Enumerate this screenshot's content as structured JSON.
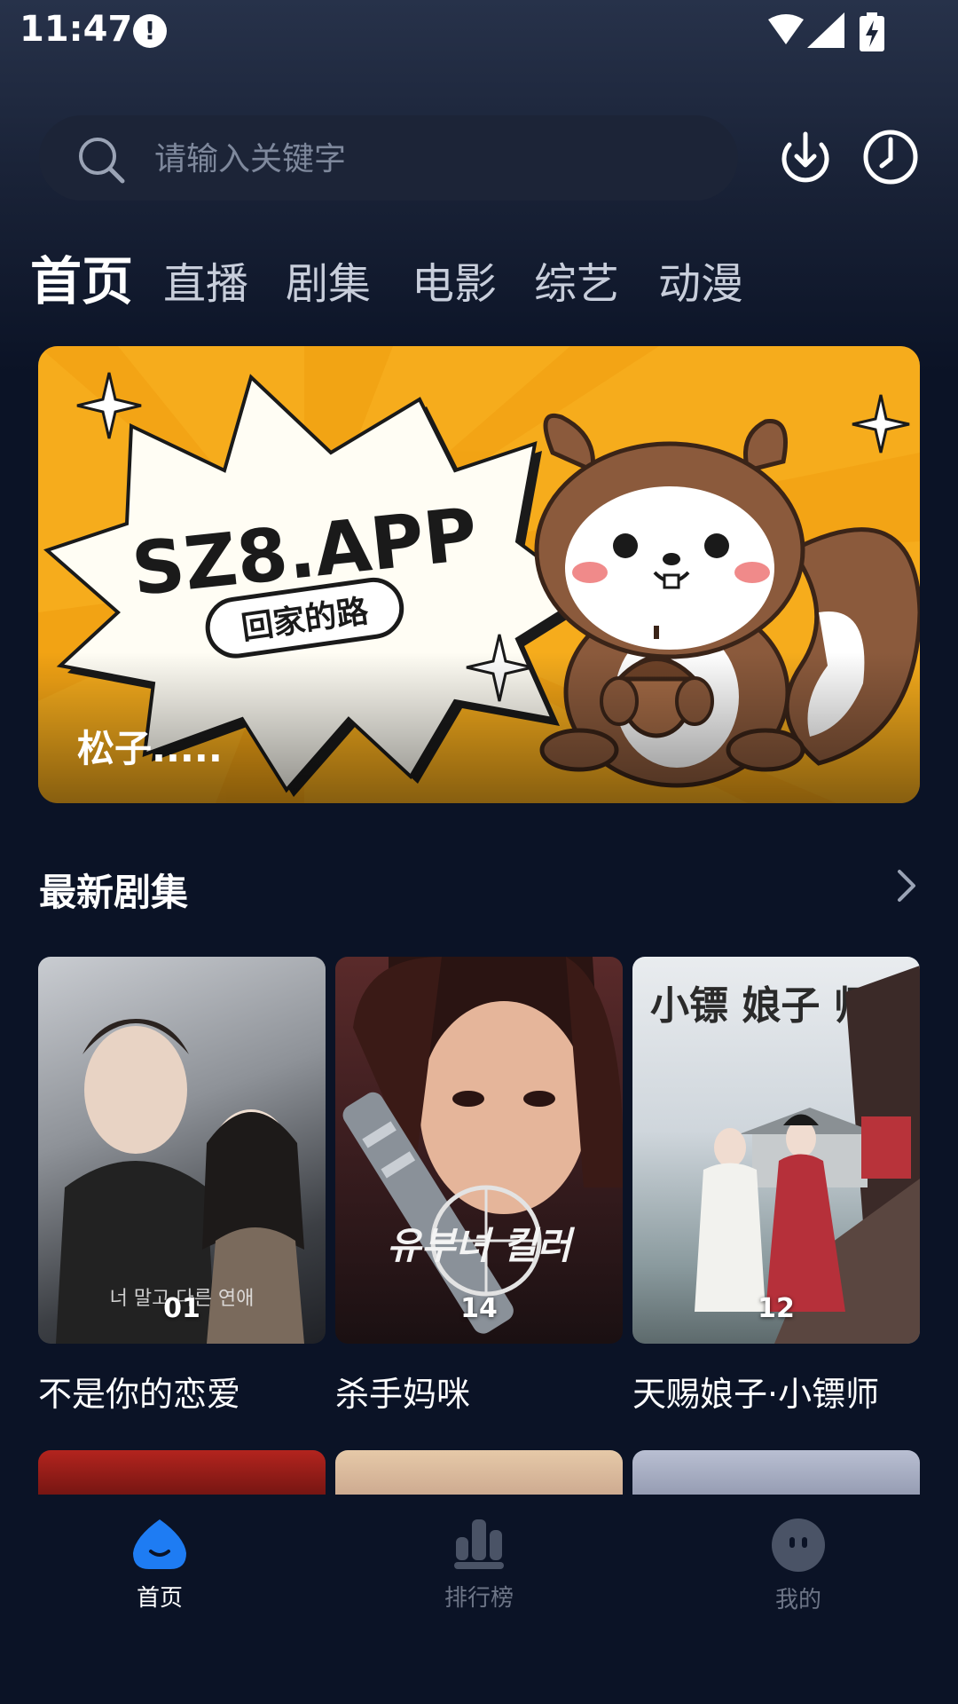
{
  "status_bar": {
    "time": "11:47",
    "alert": "!"
  },
  "search": {
    "placeholder": "请输入关键字"
  },
  "tabs": [
    {
      "label": "首页",
      "active": true
    },
    {
      "label": "直播"
    },
    {
      "label": "剧集"
    },
    {
      "label": "电影"
    },
    {
      "label": "综艺"
    },
    {
      "label": "动漫"
    }
  ],
  "banner": {
    "caption": "松子.....",
    "logo_text": "SZ8.APP",
    "slogan": "回家的路"
  },
  "section": {
    "title": "最新剧集"
  },
  "dramas": [
    {
      "title": "不是你的恋爱",
      "episode": "01",
      "poster_title": "너 말고 다른 연애"
    },
    {
      "title": "杀手妈咪",
      "episode": "14",
      "poster_title": "유부녀 킬러"
    },
    {
      "title": "天赐娘子·小镖师",
      "episode": "12",
      "poster_title": "小镖 娘子 师"
    }
  ],
  "bottom_nav": [
    {
      "label": "首页",
      "icon": "home-smile-icon",
      "active": true
    },
    {
      "label": "排行榜",
      "icon": "bar-chart-icon"
    },
    {
      "label": "我的",
      "icon": "profile-face-icon"
    }
  ],
  "colors": {
    "accent": "#1e7cf3",
    "background": "#0b1326",
    "banner": "#f6ac1c"
  }
}
